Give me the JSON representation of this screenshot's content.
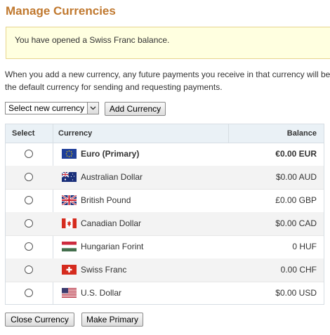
{
  "page_title": "Manage Currencies",
  "notice": "You have opened a Swiss Franc balance.",
  "intro": {
    "line1": "When you add a new currency, any future payments you receive in that currency will be",
    "line2": "the default currency for sending and requesting payments."
  },
  "controls": {
    "select_value": "Select new currency",
    "add_button": "Add Currency"
  },
  "table": {
    "headers": {
      "select": "Select",
      "currency": "Currency",
      "balance": "Balance"
    },
    "rows": [
      {
        "flag": "eu-flag-icon",
        "name": "Euro (Primary)",
        "balance": "€0.00 EUR",
        "primary": true
      },
      {
        "flag": "australia-flag-icon",
        "name": "Australian Dollar",
        "balance": "$0.00 AUD"
      },
      {
        "flag": "uk-flag-icon",
        "name": "British Pound",
        "balance": "£0.00 GBP"
      },
      {
        "flag": "canada-flag-icon",
        "name": "Canadian Dollar",
        "balance": "$0.00 CAD"
      },
      {
        "flag": "hungary-flag-icon",
        "name": "Hungarian Forint",
        "balance": "0 HUF"
      },
      {
        "flag": "switzerland-flag-icon",
        "name": "Swiss Franc",
        "balance": "0.00 CHF"
      },
      {
        "flag": "usa-flag-icon",
        "name": "U.S. Dollar",
        "balance": "$0.00 USD"
      }
    ]
  },
  "actions": {
    "close_currency": "Close Currency",
    "make_primary": "Make Primary"
  },
  "colors": {
    "title": "#c0782e",
    "notice_bg": "#ffffe0",
    "header_bg": "#eaf1f6",
    "alt_row": "#f3f3f3"
  }
}
